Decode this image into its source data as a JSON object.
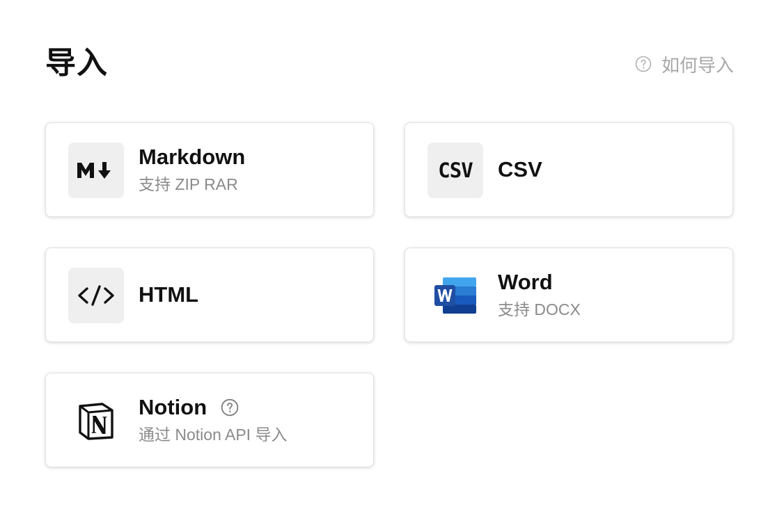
{
  "header": {
    "title": "导入",
    "help_label": "如何导入",
    "help_icon": "question-circle-icon"
  },
  "import_options": [
    {
      "name": "Markdown",
      "description": "支持 ZIP RAR",
      "icon": "markdown-icon",
      "icon_text": "M↓"
    },
    {
      "name": "CSV",
      "description": "",
      "icon": "csv-icon",
      "icon_text": "CSV"
    },
    {
      "name": "HTML",
      "description": "",
      "icon": "code-icon",
      "icon_text": "</>"
    },
    {
      "name": "Word",
      "description": "支持 DOCX",
      "icon": "word-icon",
      "icon_text": "W"
    },
    {
      "name": "Notion",
      "description": "通过 Notion API 导入",
      "icon": "notion-icon",
      "icon_text": "N",
      "help_icon": "question-circle-icon"
    }
  ],
  "colors": {
    "card_border": "#e3e3e3",
    "icon_background": "#efefef",
    "muted_text": "#8a8a8a",
    "help_text": "#a8a8a8",
    "word_blue_dark": "#1f4ea3",
    "word_blue_light": "#41a5ee"
  }
}
